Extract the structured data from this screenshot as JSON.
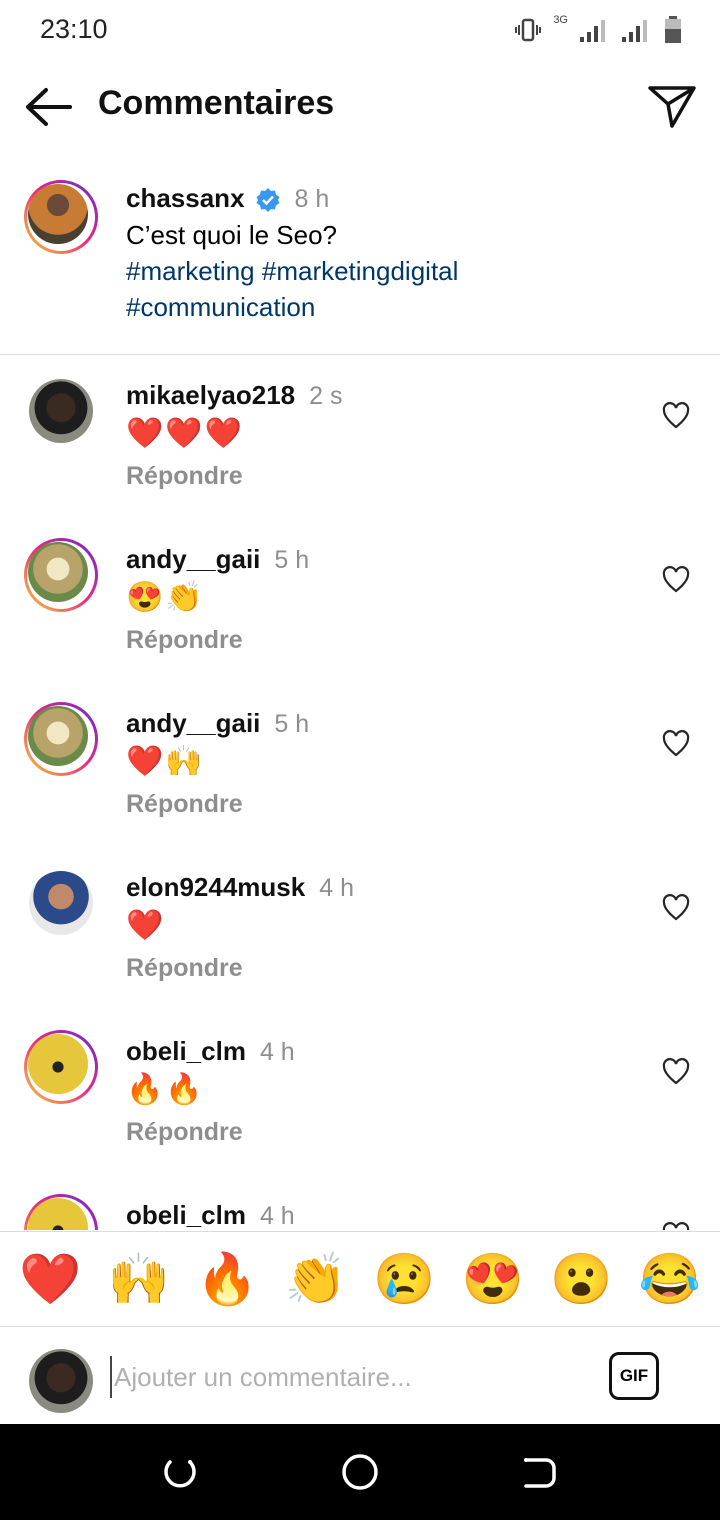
{
  "status_bar": {
    "time": "23:10",
    "network": "3G"
  },
  "header": {
    "title": "Commentaires",
    "back_icon": "arrow-left-icon",
    "send_icon": "paper-plane-icon"
  },
  "caption": {
    "username": "chassanx",
    "verified": true,
    "time": "8 h",
    "text": "C’est quoi le Seo?",
    "hashtag_1": "#marketing",
    "hashtag_2": "#marketingdigital",
    "hashtag_3": "#communication"
  },
  "comments": [
    {
      "username": "mikaelyao218",
      "time": "2 s",
      "text": "❤️❤️❤️",
      "reply": "Répondre"
    },
    {
      "username": "andy__gaii",
      "time": "5 h",
      "text": "😍👏",
      "reply": "Répondre"
    },
    {
      "username": "andy__gaii",
      "time": "5 h",
      "text": "❤️🙌",
      "reply": "Répondre"
    },
    {
      "username": "elon9244musk",
      "time": "4 h",
      "text": "❤️",
      "reply": "Répondre"
    },
    {
      "username": "obeli_clm",
      "time": "4 h",
      "text": "🔥🔥",
      "reply": "Répondre"
    },
    {
      "username": "obeli_clm",
      "time": "4 h",
      "text": "",
      "reply": ""
    }
  ],
  "emoji_bar": [
    "❤️",
    "🙌",
    "🔥",
    "👏",
    "😢",
    "😍",
    "😮",
    "😂"
  ],
  "input": {
    "placeholder": "Ajouter un commentaire...",
    "gif_label": "GIF"
  },
  "colors": {
    "hashtag": "#00376b",
    "secondary_text": "#8e8e8e",
    "divider": "#dbdbdb",
    "verified": "#3897f0"
  }
}
